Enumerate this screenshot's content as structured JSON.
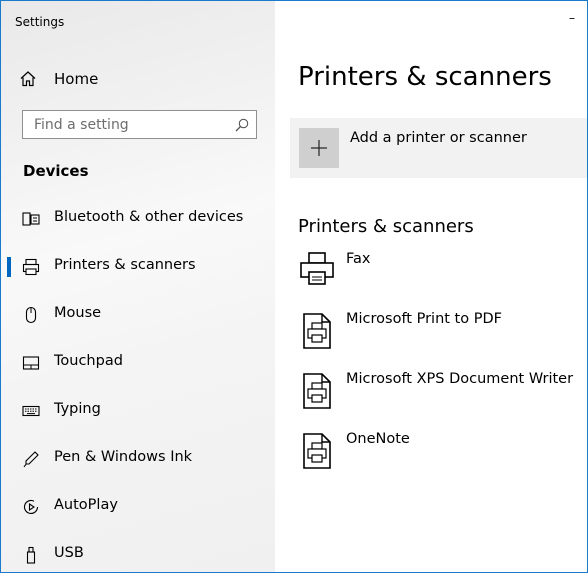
{
  "window": {
    "title": "Settings",
    "minimize_glyph": "–"
  },
  "sidebar": {
    "home_label": "Home",
    "search_placeholder": "Find a setting",
    "section_title": "Devices",
    "items": [
      {
        "label": "Bluetooth & other devices",
        "icon": "bluetooth-devices-icon",
        "selected": false
      },
      {
        "label": "Printers & scanners",
        "icon": "printer-icon",
        "selected": true
      },
      {
        "label": "Mouse",
        "icon": "mouse-icon",
        "selected": false
      },
      {
        "label": "Touchpad",
        "icon": "touchpad-icon",
        "selected": false
      },
      {
        "label": "Typing",
        "icon": "keyboard-icon",
        "selected": false
      },
      {
        "label": "Pen & Windows Ink",
        "icon": "pen-icon",
        "selected": false
      },
      {
        "label": "AutoPlay",
        "icon": "autoplay-icon",
        "selected": false
      },
      {
        "label": "USB",
        "icon": "usb-icon",
        "selected": false
      }
    ]
  },
  "main": {
    "page_title": "Printers & scanners",
    "add_label": "Add a printer or scanner",
    "list_heading": "Printers & scanners",
    "printers": [
      {
        "name": "Fax",
        "icon": "fax-icon"
      },
      {
        "name": "Microsoft Print to PDF",
        "icon": "print-document-icon"
      },
      {
        "name": "Microsoft XPS Document Writer",
        "icon": "print-document-icon"
      },
      {
        "name": "OneNote",
        "icon": "print-document-icon"
      }
    ]
  },
  "colors": {
    "accent": "#0067c0",
    "window_border": "#1979ca",
    "tile_bg": "#f2f2f2",
    "plus_bg": "#cfcfcf"
  }
}
